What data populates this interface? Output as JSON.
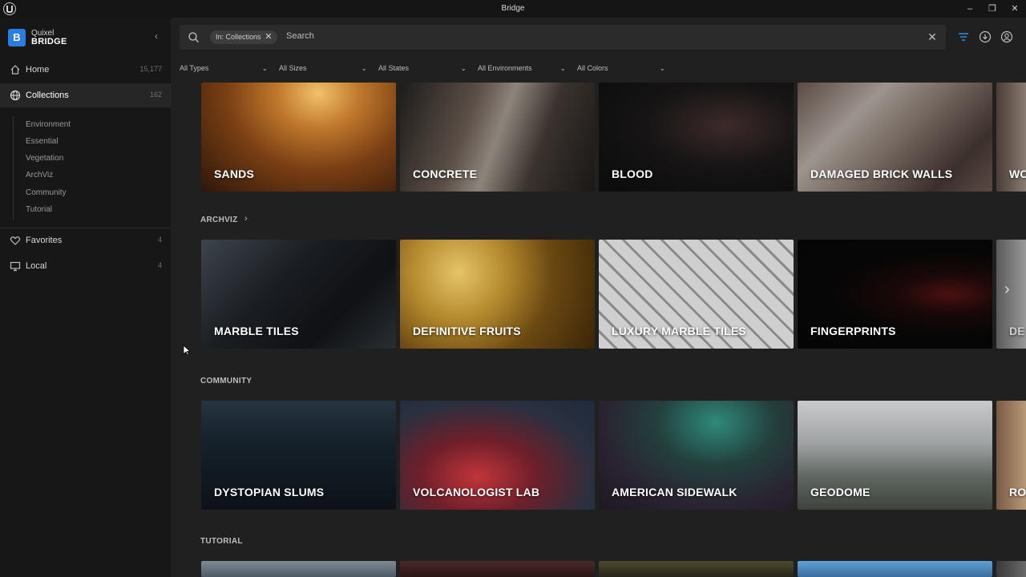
{
  "window": {
    "title": "Bridge",
    "controls": {
      "minimize": "–",
      "restore": "❐",
      "close": "✕"
    }
  },
  "brand": {
    "name_line1": "Quixel",
    "name_line2": "BRIDGE",
    "badge": "B"
  },
  "sidebar": {
    "collapse_glyph": "‹",
    "items": [
      {
        "label": "Home",
        "count": "15,177",
        "icon": "home-icon"
      },
      {
        "label": "Collections",
        "count": "162",
        "icon": "globe-icon",
        "active": true
      },
      {
        "label": "Favorites",
        "count": "4",
        "icon": "heart-icon"
      },
      {
        "label": "Local",
        "count": "4",
        "icon": "monitor-icon"
      }
    ],
    "collections_sub": [
      "Environment",
      "Essential",
      "Vegetation",
      "ArchViz",
      "Community",
      "Tutorial"
    ]
  },
  "search": {
    "chip_label": "In: Collections",
    "chip_close": "✕",
    "placeholder": "Search",
    "clear_glyph": "✕"
  },
  "toolbar_icons": [
    "filter-icon",
    "download-icon",
    "account-icon"
  ],
  "filters": [
    {
      "label": "All Types"
    },
    {
      "label": "All Sizes"
    },
    {
      "label": "All States"
    },
    {
      "label": "All Environments"
    },
    {
      "label": "All Colors"
    }
  ],
  "rows": [
    {
      "title": "",
      "cards": [
        "SANDS",
        "CONCRETE",
        "BLOOD",
        "DAMAGED BRICK WALLS",
        "WO"
      ]
    },
    {
      "title": "ARCHVIZ",
      "cards": [
        "MARBLE TILES",
        "DEFINITIVE FRUITS",
        "LUXURY MARBLE TILES",
        "FINGERPRINTS",
        "DE"
      ]
    },
    {
      "title": "COMMUNITY",
      "cards": [
        "DYSTOPIAN SLUMS",
        "VOLCANOLOGIST LAB",
        "AMERICAN SIDEWALK",
        "GEODOME",
        "RO"
      ]
    },
    {
      "title": "TUTORIAL",
      "cards": [
        "",
        "",
        "",
        "",
        ""
      ]
    }
  ],
  "glyphs": {
    "chevron_down": "⌄",
    "chevron_right": "›",
    "next": "›"
  },
  "colors": {
    "accent": "#2a7de1",
    "background": "#202020",
    "sidebar": "#171717"
  }
}
